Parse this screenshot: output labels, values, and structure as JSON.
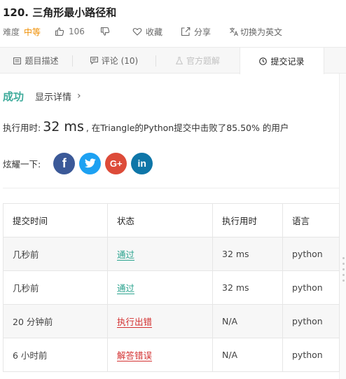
{
  "problem": {
    "title": "120. 三角形最小路径和",
    "difficulty_label": "难度",
    "difficulty": "中等",
    "likes": "106",
    "favorite_label": "收藏",
    "share_label": "分享",
    "translate_label": "切换为英文"
  },
  "tabs": [
    {
      "label": "题目描述",
      "icon": "description-icon",
      "state": "normal"
    },
    {
      "label": "评论 (10)",
      "icon": "comment-icon",
      "state": "normal"
    },
    {
      "label": "官方题解",
      "icon": "flask-icon",
      "state": "disabled"
    },
    {
      "label": "提交记录",
      "icon": "clock-icon",
      "state": "active"
    }
  ],
  "result": {
    "status": "成功",
    "details_label": "显示详情",
    "details_chevron": "›",
    "runtime_prefix": "执行用时:",
    "runtime_value": "32 ms",
    "runtime_suffix": ", 在Triangle的Python提交中击败了85.50% 的用户"
  },
  "share": {
    "label": "炫耀一下:",
    "networks": [
      {
        "name": "facebook",
        "glyph": "f",
        "color": "#3b5998"
      },
      {
        "name": "twitter",
        "glyph": "twitter-bird",
        "color": "#1da1f2"
      },
      {
        "name": "google-plus",
        "glyph": "G+",
        "color": "#dd4b39"
      },
      {
        "name": "linkedin",
        "glyph": "in",
        "color": "#0e76a8"
      }
    ]
  },
  "submissions": {
    "headers": [
      "提交时间",
      "状态",
      "执行用时",
      "语言"
    ],
    "rows": [
      {
        "time": "几秒前",
        "status": "通过",
        "status_type": "ok",
        "runtime": "32 ms",
        "language": "python"
      },
      {
        "time": "几秒前",
        "status": "通过",
        "status_type": "ok",
        "runtime": "32 ms",
        "language": "python"
      },
      {
        "time": "20 分钟前",
        "status": "执行出错",
        "status_type": "err",
        "runtime": "N/A",
        "language": "python"
      },
      {
        "time": "6 小时前",
        "status": "解答错误",
        "status_type": "err",
        "runtime": "N/A",
        "language": "python"
      }
    ]
  },
  "colors": {
    "success": "#3eab9b",
    "accepted": "#28a28d",
    "error": "#d32f2f",
    "difficulty_medium": "#ef8e00"
  }
}
